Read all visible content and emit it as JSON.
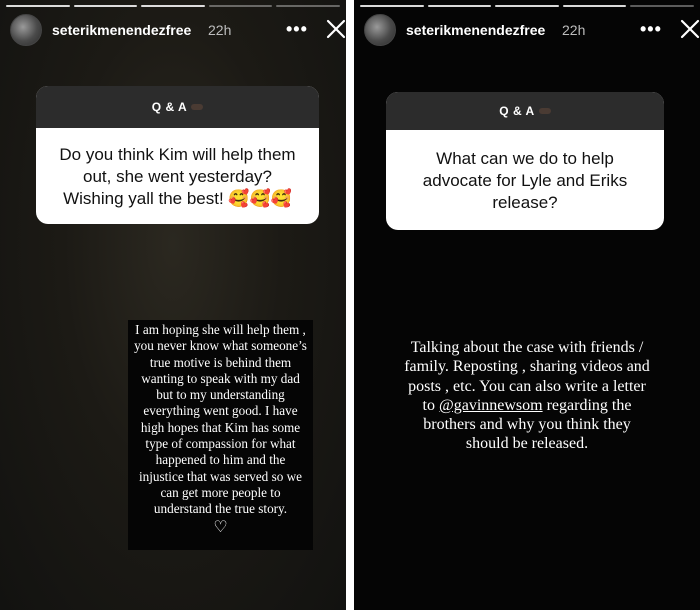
{
  "stories": [
    {
      "username": "seterikmenendezfree",
      "time": "22h",
      "more_label": "•••",
      "qa_label": "Q & A",
      "question": "Do you think Kim will help them out, she went yesterday? Wishing yall the best! 🥰🥰🥰",
      "answer": "I am hoping she will help them , you never know what someone’s true motive is behind them wanting to speak with my dad but to my understanding everything went good. I have high hopes that Kim has some type of compassion for what happened to him and the injustice that was served so we can get more people to understand the true story.",
      "answer_emoji": "♡"
    },
    {
      "username": "seterikmenendezfree",
      "time": "22h",
      "more_label": "•••",
      "qa_label": "Q & A",
      "question": "What can we do to help advocate for Lyle and Eriks release?",
      "answer_part1": "Talking about the case with friends / family. Reposting , sharing videos and posts , etc. You can also write a letter to ",
      "answer_mention": "@gavinnewsom",
      "answer_part2": " regarding the brothers and why you think they should be released."
    }
  ]
}
